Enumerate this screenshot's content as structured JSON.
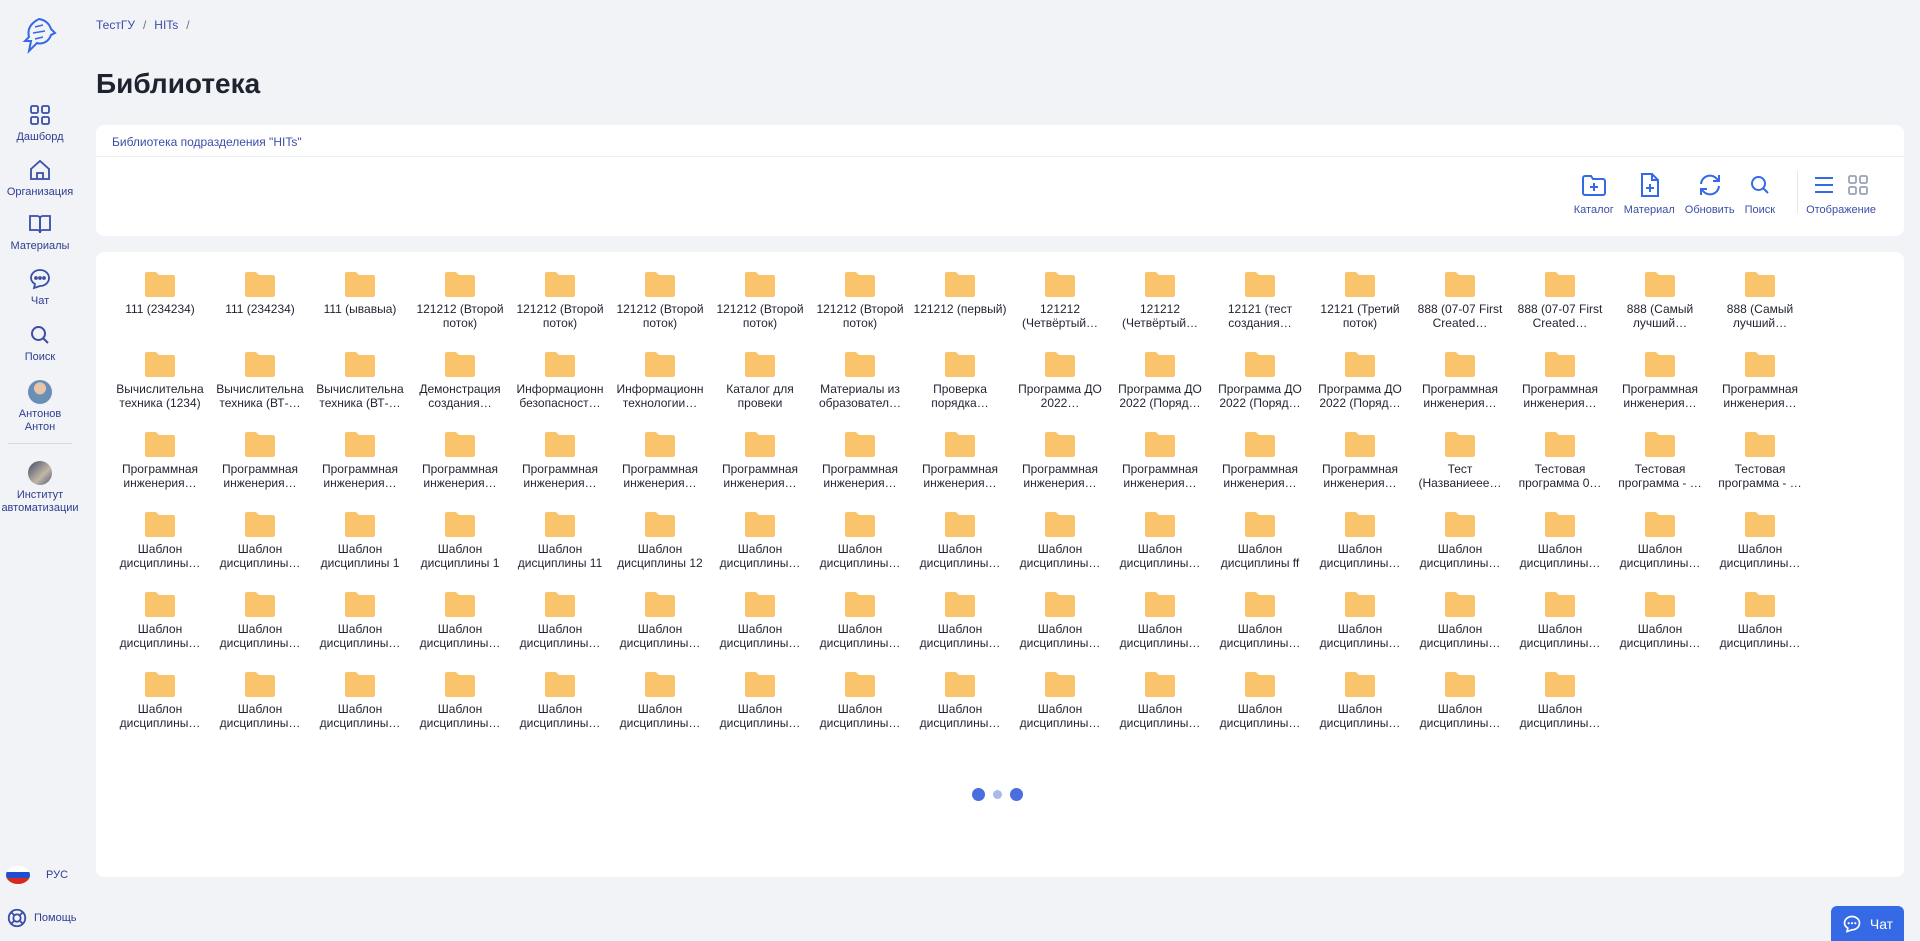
{
  "sidebar": {
    "items": [
      {
        "label": "Дашборд",
        "icon": "dashboard-icon"
      },
      {
        "label": "Организация",
        "icon": "home-icon"
      },
      {
        "label": "Материалы",
        "icon": "book-icon"
      },
      {
        "label": "Чат",
        "icon": "chat-icon"
      },
      {
        "label": "Поиск",
        "icon": "search-icon"
      }
    ],
    "user": {
      "label": "Антонов\nАнтон"
    },
    "org": {
      "label": "Институт автоматизации"
    },
    "lang": "РУС",
    "help": "Помощь"
  },
  "breadcrumb": [
    "ТестГУ",
    "HITs"
  ],
  "page_title": "Библиотека",
  "header": {
    "subtitle": "Библиотека подразделения \"HITs\"",
    "tools": {
      "catalog": "Каталог",
      "material": "Материал",
      "refresh": "Обновить",
      "search": "Поиск",
      "view": "Отображение"
    }
  },
  "files": [
    "111 (234234)",
    "111 (234234)",
    "111 (ывавыа)",
    "121212 (Второй поток)",
    "121212 (Второй поток)",
    "121212 (Второй поток)",
    "121212 (Второй поток)",
    "121212 (Второй поток)",
    "121212 (первый)",
    "121212 (Четвёртый…",
    "121212 (Четвёртый…",
    "12121 (тест создания…",
    "12121 (Третий поток)",
    "888 (07-07 First Created…",
    "888 (07-07 First Created…",
    "888 (Самый лучший…",
    "888 (Самый лучший…",
    "Вычислительна техника (1234)",
    "Вычислительна техника (ВТ-…",
    "Вычислительна техника (ВТ-…",
    "Демонстрация создания…",
    "Информационн безопасност…",
    "Информационн технологии…",
    "Каталог для провеки",
    "Материалы из образовател…",
    "Проверка порядка…",
    "Программа ДО 2022…",
    "Программа ДО 2022 (Поряд…",
    "Программа ДО 2022 (Поряд…",
    "Программа ДО 2022 (Поряд…",
    "Программная инженерия…",
    "Программная инженерия…",
    "Программная инженерия…",
    "Программная инженерия…",
    "Программная инженерия…",
    "Программная инженерия…",
    "Программная инженерия…",
    "Программная инженерия…",
    "Программная инженерия…",
    "Программная инженерия…",
    "Программная инженерия…",
    "Программная инженерия…",
    "Программная инженерия…",
    "Программная инженерия…",
    "Программная инженерия…",
    "Программная инженерия…",
    "Программная инженерия…",
    "Тест (Названиеее…",
    "Тестовая программа 0…",
    "Тестовая программа - …",
    "Тестовая программа - …",
    "Шаблон дисциплины…",
    "Шаблон дисциплины…",
    "Шаблон дисциплины 1",
    "Шаблон дисциплины 1",
    "Шаблон дисциплины 11",
    "Шаблон дисциплины 12",
    "Шаблон дисциплины…",
    "Шаблон дисциплины…",
    "Шаблон дисциплины…",
    "Шаблон дисциплины…",
    "Шаблон дисциплины…",
    "Шаблон дисциплины ff",
    "Шаблон дисциплины…",
    "Шаблон дисциплины…",
    "Шаблон дисциплины…",
    "Шаблон дисциплины…",
    "Шаблон дисциплины…",
    "Шаблон дисциплины…",
    "Шаблон дисциплины…",
    "Шаблон дисциплины…",
    "Шаблон дисциплины…",
    "Шаблон дисциплины…",
    "Шаблон дисциплины…",
    "Шаблон дисциплины…",
    "Шаблон дисциплины…",
    "Шаблон дисциплины…",
    "Шаблон дисциплины…",
    "Шаблон дисциплины…",
    "Шаблон дисциплины…",
    "Шаблон дисциплины…",
    "Шаблон дисциплины…",
    "Шаблон дисциплины…",
    "Шаблон дисциплины…",
    "Шаблон дисциплины…",
    "Шаблон дисциплины…",
    "Шаблон дисциплины…",
    "Шаблон дисциплины…",
    "Шаблон дисциплины…",
    "Шаблон дисциплины…",
    "Шаблон дисциплины…",
    "Шаблон дисциплины…",
    "Шаблон дисциплины…",
    "Шаблон дисциплины…",
    "Шаблон дисциплины…",
    "Шаблон дисциплины…",
    "Шаблон дисциплины…",
    "Шаблон дисциплины…",
    "Шаблон дисциплины…",
    "Шаблон дисциплины…"
  ],
  "chat_button": "Чат",
  "colors": {
    "accent": "#3b4ea8",
    "folder": "#f9c46b",
    "chat": "#3569e6"
  }
}
